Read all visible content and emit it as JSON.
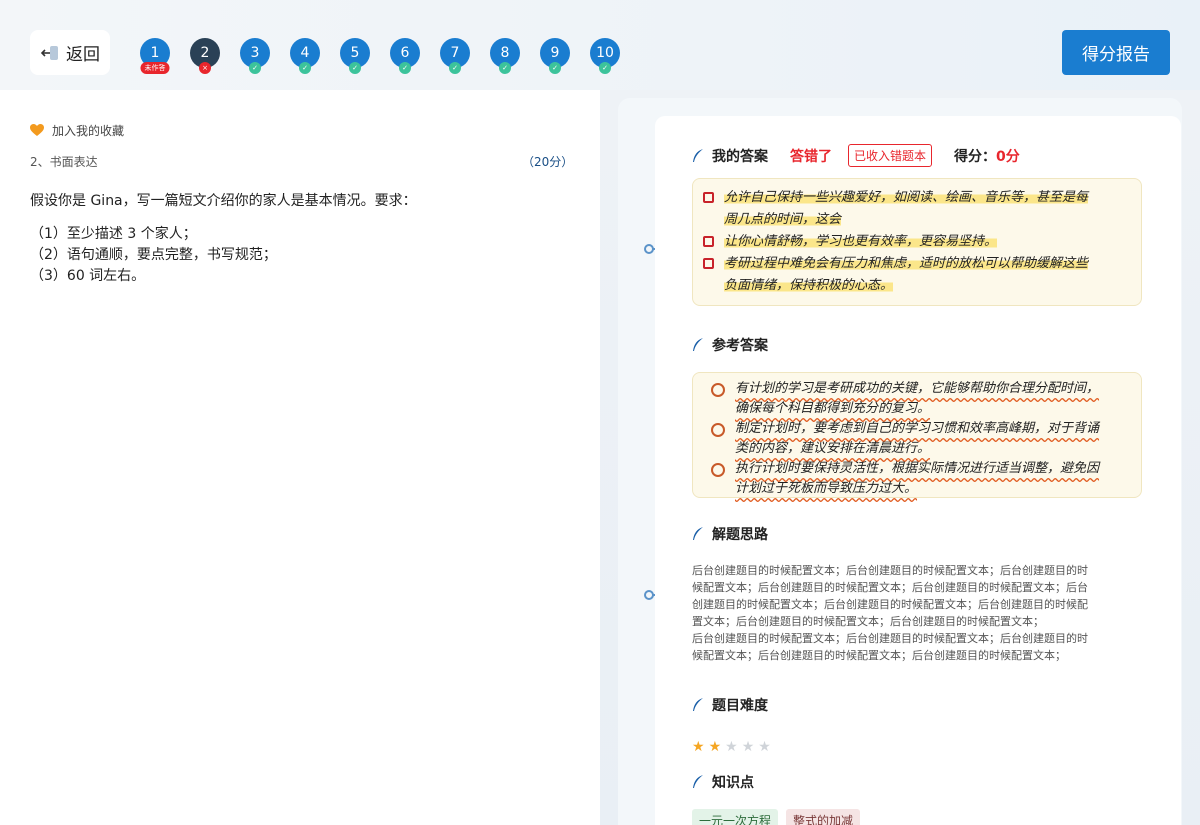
{
  "header": {
    "back_label": "返回",
    "report_label": "得分报告",
    "questions": [
      {
        "num": "1",
        "style": "blue",
        "badge": "未作答",
        "badge_type": "red"
      },
      {
        "num": "2",
        "style": "dark",
        "badge": "×",
        "badge_type": "red-x"
      },
      {
        "num": "3",
        "style": "blue",
        "badge": "✓",
        "badge_type": "green"
      },
      {
        "num": "4",
        "style": "blue",
        "badge": "✓",
        "badge_type": "green"
      },
      {
        "num": "5",
        "style": "blue",
        "badge": "✓",
        "badge_type": "green"
      },
      {
        "num": "6",
        "style": "blue",
        "badge": "✓",
        "badge_type": "green"
      },
      {
        "num": "7",
        "style": "blue",
        "badge": "✓",
        "badge_type": "green"
      },
      {
        "num": "8",
        "style": "blue",
        "badge": "✓",
        "badge_type": "green"
      },
      {
        "num": "9",
        "style": "blue",
        "badge": "✓",
        "badge_type": "green"
      },
      {
        "num": "10",
        "style": "blue",
        "badge": "✓",
        "badge_type": "green"
      }
    ]
  },
  "question": {
    "favorite_label": "加入我的收藏",
    "type_label": "2、书面表达",
    "score_label": "（20分）",
    "prompt": "假设你是 Gina，写一篇短文介绍你的家人是基本情况。要求：",
    "requirements": [
      "（1）至少描述 3 个家人；",
      "（2）语句通顺，要点完整，书写规范；",
      "（3）60 词左右。"
    ]
  },
  "answer": {
    "my_answer_title": "我的答案",
    "wrong_label": "答错了",
    "in_book_label": "已收入错题本",
    "score_label": "得分：",
    "score_value": "0分",
    "my_answer_lines": [
      {
        "line1": "允许自己保持一些兴趣爱好，如阅读、绘画、音乐等，甚至是每",
        "line2": "周几点的时间，这会"
      },
      {
        "line1": "让你心情舒畅，学习也更有效率，更容易坚持。",
        "line2": ""
      },
      {
        "line1": "考研过程中难免会有压力和焦虑，适时的放松可以帮助缓解这些",
        "line2": "负面情绪，保持积极的心态。"
      }
    ],
    "ref_answer_title": "参考答案",
    "ref_answer_lines": [
      {
        "line1": "有计划的学习是考研成功的关键，它能够帮助你合理分配时间，",
        "line2": "确保每个科目都得到充分的复习。"
      },
      {
        "line1": "制定计划时，要考虑到自己的学习习惯和效率高峰期，对于背诵",
        "line2": "类的内容，建议安排在清晨进行。"
      },
      {
        "line1": "执行计划时要保持灵活性，根据实际情况进行适当调整，避免因",
        "line2": "计划过于死板而导致压力过大。"
      }
    ],
    "analysis_title": "解题思路",
    "analysis_lines": [
      "后台创建题目的时候配置文本；后台创建题目的时候配置文本；后台创建题目的时",
      "候配置文本；后台创建题目的时候配置文本；后台创建题目的时候配置文本；后台",
      "创建题目的时候配置文本；后台创建题目的时候配置文本；后台创建题目的时候配",
      "置文本；后台创建题目的时候配置文本；后台创建题目的时候配置文本；",
      "后台创建题目的时候配置文本；后台创建题目的时候配置文本；后台创建题目的时",
      "候配置文本；后台创建题目的时候配置文本；后台创建题目的时候配置文本；"
    ],
    "difficulty_title": "题目难度",
    "difficulty_stars": 2,
    "difficulty_max": 5,
    "knowledge_title": "知识点",
    "knowledge_tags": [
      "一元一次方程",
      "整式的加减"
    ]
  },
  "colors": {
    "accent": "#1a7dd0",
    "error": "#e8262d",
    "success": "#3cc39b",
    "star_on": "#f5a623",
    "star_off": "#d0d4d9"
  }
}
